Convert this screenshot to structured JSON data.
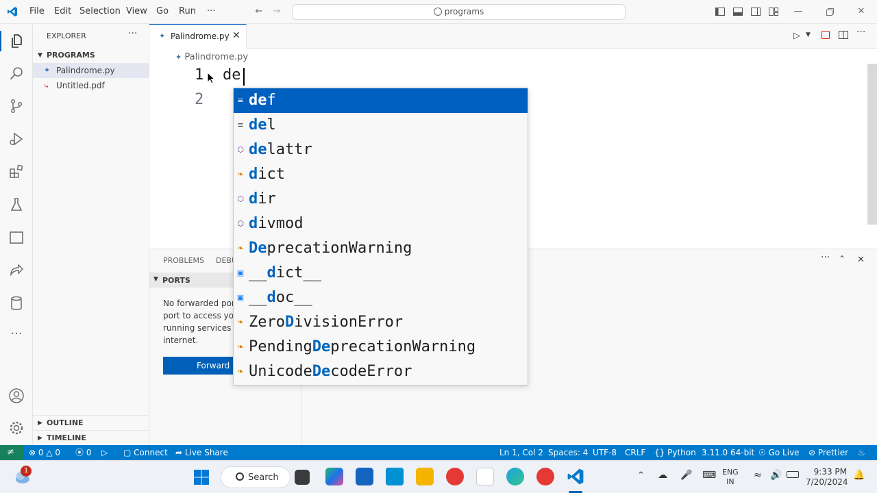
{
  "titlebar": {
    "menu": [
      "File",
      "Edit",
      "Selection",
      "View",
      "Go",
      "Run",
      "···"
    ],
    "search_text": "programs"
  },
  "sidebar": {
    "title": "EXPLORER",
    "folder": "PROGRAMS",
    "files": [
      {
        "name": "Palindrome.py",
        "icon": "python-file-icon"
      },
      {
        "name": "Untitled.pdf",
        "icon": "pdf-file-icon"
      }
    ],
    "outline": "OUTLINE",
    "timeline": "TIMELINE"
  },
  "editor": {
    "tab_label": "Palindrome.py",
    "breadcrumb": "Palindrome.py",
    "line_numbers": [
      "1",
      "2"
    ],
    "line1_text": "de"
  },
  "suggest": {
    "items": [
      {
        "pre": "",
        "hl": "de",
        "post": "f",
        "icon": "keyword-icon",
        "icon_glyph": "≡",
        "icon_color": "#424242"
      },
      {
        "pre": "",
        "hl": "de",
        "post": "l",
        "icon": "keyword-icon",
        "icon_glyph": "≡",
        "icon_color": "#424242"
      },
      {
        "pre": "",
        "hl": "de",
        "post": "lattr",
        "icon": "method-icon",
        "icon_glyph": "⬡",
        "icon_color": "#652d90"
      },
      {
        "pre": "",
        "hl": "d",
        "post": "ict",
        "icon": "class-icon",
        "icon_glyph": "❧",
        "icon_color": "#d67e00"
      },
      {
        "pre": "",
        "hl": "d",
        "post": "ir",
        "icon": "method-icon",
        "icon_glyph": "⬡",
        "icon_color": "#652d90"
      },
      {
        "pre": "",
        "hl": "d",
        "post": "ivmod",
        "icon": "method-icon",
        "icon_glyph": "⬡",
        "icon_color": "#652d90"
      },
      {
        "pre": "",
        "hl": "De",
        "post": "precationWarning",
        "icon": "class-icon",
        "icon_glyph": "❧",
        "icon_color": "#d67e00"
      },
      {
        "pre": "__",
        "hl": "d",
        "post": "ict__",
        "icon": "variable-icon",
        "icon_glyph": "▣",
        "icon_color": "#1a85ff"
      },
      {
        "pre": "__",
        "hl": "d",
        "post": "oc__",
        "icon": "variable-icon",
        "icon_glyph": "▣",
        "icon_color": "#1a85ff"
      },
      {
        "pre": "Zero",
        "hl": "D",
        "post": "ivisionError",
        "icon": "class-icon",
        "icon_glyph": "❧",
        "icon_color": "#d67e00"
      },
      {
        "pre": "Pending",
        "hl": "De",
        "post": "precationWarning",
        "icon": "class-icon",
        "icon_glyph": "❧",
        "icon_color": "#d67e00"
      },
      {
        "pre": "Unicode",
        "hl": "De",
        "post": "codeError",
        "icon": "class-icon",
        "icon_glyph": "❧",
        "icon_color": "#d67e00"
      }
    ]
  },
  "panel": {
    "tabs": [
      "PROBLEMS",
      "DEBU"
    ],
    "section": "PORTS",
    "message_lines": [
      "No forwarded por",
      "port to access you",
      "running services c",
      "internet."
    ],
    "button": "Forward a"
  },
  "statusbar": {
    "errors": "0",
    "warnings": "0",
    "ports": "0",
    "connect": "Connect",
    "live_share": "Live Share",
    "position": "Ln 1, Col 2",
    "spaces": "Spaces: 4",
    "encoding": "UTF-8",
    "eol": "CRLF",
    "language": "Python",
    "interpreter": "3.11.0 64-bit",
    "go_live": "Go Live",
    "prettier": "Prettier"
  },
  "taskbar": {
    "search": "Search",
    "lang_line1": "ENG",
    "lang_line2": "IN",
    "time": "9:33 PM",
    "date": "7/20/2024",
    "notification_count": "1"
  }
}
